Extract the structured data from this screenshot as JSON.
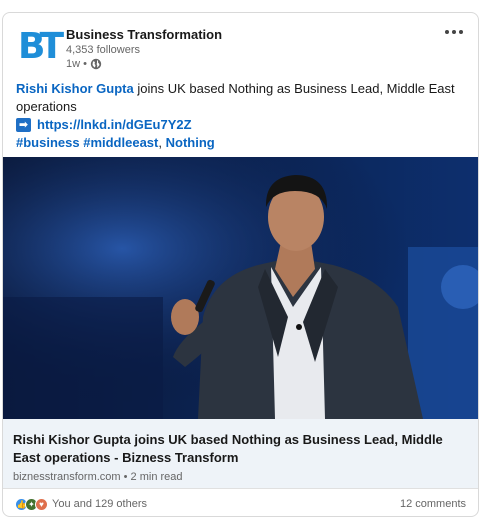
{
  "post": {
    "author": {
      "logo_text": "BT",
      "name": "Business Transformation",
      "followers": "4,353 followers",
      "time": "1w •"
    },
    "text": {
      "mention": "Rishi Kishor Gupta",
      "headline_rest": " joins UK based Nothing as Business Lead, Middle East operations",
      "arrow": "➡",
      "link": "https://lnkd.in/dGEu7Y2Z",
      "hashtag_1": "#business",
      "hashtag_2": "#middleeast",
      "hashtag_sep": ", ",
      "mention_2": "Nothing"
    },
    "article": {
      "title": "Rishi Kishor Gupta joins UK based Nothing as Business Lead, Middle East operations - Bizness Transform",
      "meta": "biznesstransform.com • 2 min read"
    },
    "social": {
      "reactions_text": "You and 129 others",
      "comments": "12 comments"
    }
  },
  "colors": {
    "link": "#0a66c2",
    "logo": "#1f8ed8",
    "like": "#378fe9",
    "celebrate": "#44712e",
    "love": "#df704d"
  },
  "icons": {
    "more": "more-horizontal-icon",
    "visibility": "globe-icon",
    "link_prefix": "arrow-right-icon",
    "reactions": [
      "like-icon",
      "celebrate-icon",
      "love-icon"
    ]
  }
}
